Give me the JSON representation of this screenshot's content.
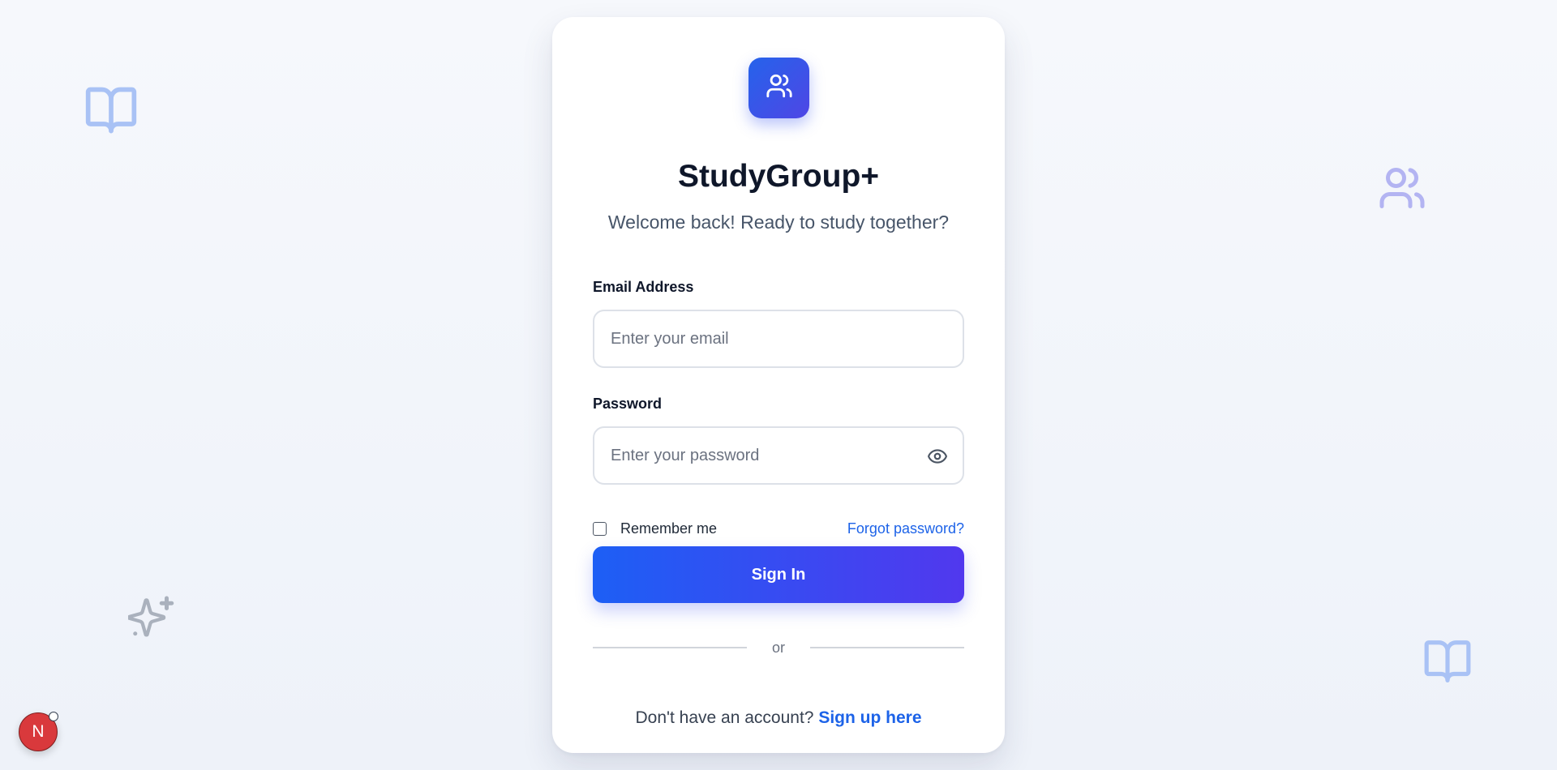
{
  "app": {
    "title": "StudyGroup+",
    "subtitle": "Welcome back! Ready to study together?"
  },
  "form": {
    "email_label": "Email Address",
    "email_placeholder": "Enter your email",
    "email_value": "",
    "password_label": "Password",
    "password_placeholder": "Enter your password",
    "password_value": "",
    "remember_label": "Remember me",
    "remember_checked": false,
    "forgot_label": "Forgot password?",
    "signin_label": "Sign In",
    "divider_text": "or",
    "signup_prompt": "Don't have an account?",
    "signup_link": "Sign up here"
  },
  "avatar": {
    "initial": "N"
  },
  "icons": {
    "logo": "users-icon",
    "password_toggle": "eye-icon",
    "decorations": [
      "book-open-icon",
      "users-icon",
      "sparkles-icon",
      "book-open-icon"
    ]
  },
  "colors": {
    "accent": "#1d63e8",
    "gradient_start": "#1d5ff5",
    "gradient_end": "#5138ee",
    "avatar": "#d9393c"
  }
}
